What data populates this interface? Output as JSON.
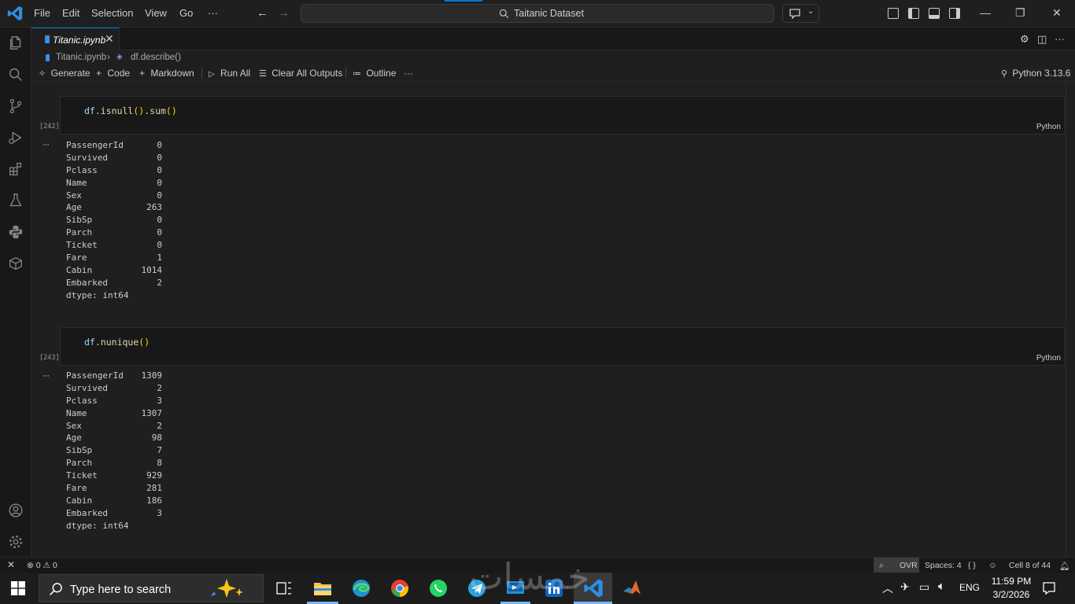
{
  "titlebar": {
    "menu": [
      "File",
      "Edit",
      "Selection",
      "View",
      "Go",
      "···"
    ],
    "search": "Taitanic Dataset"
  },
  "tab": {
    "label": "Titanic.ipynb",
    "close": "✕"
  },
  "breadcrumb": {
    "file": "Titanic.ipynb",
    "separator": "›",
    "symbol": "df.describe()"
  },
  "toolbar": {
    "generate": "Generate",
    "code": "Code",
    "markdown": "Markdown",
    "run_all": "Run All",
    "clear_outputs": "Clear All Outputs",
    "outline": "Outline",
    "more": "···",
    "kernel": "Python 3.13.6"
  },
  "cells": [
    {
      "execution_count": "[242]",
      "code_var": "df",
      "code_call": "isnull",
      "code_call2": "sum",
      "language": "Python",
      "output": [
        {
          "k": "PassengerId",
          "v": "0"
        },
        {
          "k": "Survived",
          "v": "0"
        },
        {
          "k": "Pclass",
          "v": "0"
        },
        {
          "k": "Name",
          "v": "0"
        },
        {
          "k": "Sex",
          "v": "0"
        },
        {
          "k": "Age",
          "v": "263"
        },
        {
          "k": "SibSp",
          "v": "0"
        },
        {
          "k": "Parch",
          "v": "0"
        },
        {
          "k": "Ticket",
          "v": "0"
        },
        {
          "k": "Fare",
          "v": "1"
        },
        {
          "k": "Cabin",
          "v": "1014"
        },
        {
          "k": "Embarked",
          "v": "2"
        }
      ],
      "dtype": "dtype: int64"
    },
    {
      "execution_count": "[243]",
      "code_var": "df",
      "code_call": "nunique",
      "language": "Python",
      "output": [
        {
          "k": "PassengerId",
          "v": "1309"
        },
        {
          "k": "Survived",
          "v": "2"
        },
        {
          "k": "Pclass",
          "v": "3"
        },
        {
          "k": "Name",
          "v": "1307"
        },
        {
          "k": "Sex",
          "v": "2"
        },
        {
          "k": "Age",
          "v": "98"
        },
        {
          "k": "SibSp",
          "v": "7"
        },
        {
          "k": "Parch",
          "v": "8"
        },
        {
          "k": "Ticket",
          "v": "929"
        },
        {
          "k": "Fare",
          "v": "281"
        },
        {
          "k": "Cabin",
          "v": "186"
        },
        {
          "k": "Embarked",
          "v": "3"
        }
      ],
      "dtype": "dtype: int64"
    }
  ],
  "output_dots": "···",
  "statusbar": {
    "errors": "0",
    "warnings": "0",
    "ovr": "OVR",
    "spaces": "Spaces: 4",
    "braces": "{ }",
    "cell": "Cell 8 of 44"
  },
  "taskbar": {
    "search_placeholder": "Type here to search",
    "language": "ENG",
    "time": "11:59 PM",
    "date": "3/2/2026"
  },
  "watermark": "خمسات"
}
